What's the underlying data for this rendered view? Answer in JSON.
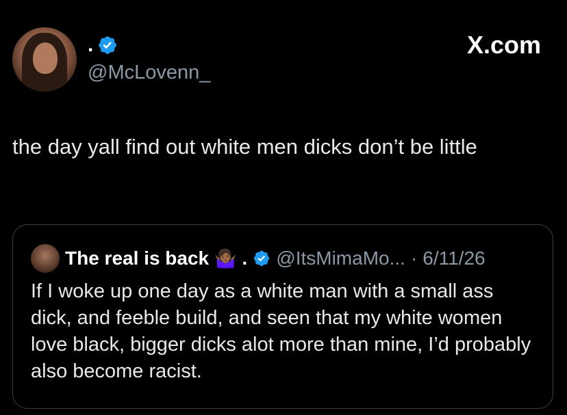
{
  "author": {
    "display_name": ".",
    "handle": "@McLovenn_",
    "avatar_icon": "profile-photo",
    "verified_icon": "verified-badge-icon"
  },
  "brand": {
    "label": "X.com"
  },
  "tweet": {
    "text": "the day yall find out white men dicks don’t be little"
  },
  "quote": {
    "display_name": "The real is back",
    "emoji": "🤷🏾‍♀️",
    "name_suffix": ".",
    "handle": "@ItsMimaMo...",
    "separator": "·",
    "date": "6/11/26",
    "text": "If I woke up one day as a white man with a small ass dick, and feeble build, and seen that my white women love black, bigger dicks alot more than mine, I’d probably also become racist."
  },
  "colors": {
    "background": "#000000",
    "text": "#e7e9ea",
    "muted": "#8b98a5",
    "verified": "#1d9bf0",
    "border": "#3b3f44"
  }
}
